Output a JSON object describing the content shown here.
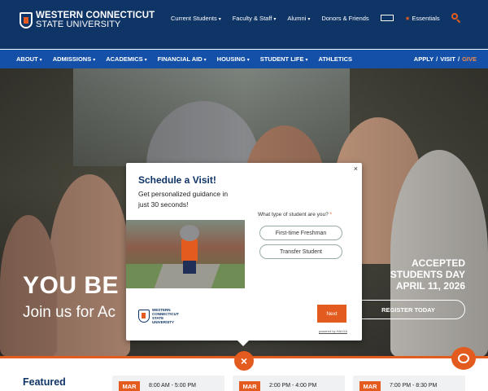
{
  "header": {
    "logo_line1": "WESTERN CONNECTICUT",
    "logo_line2": "STATE UNIVERSITY",
    "top_links": [
      {
        "label": "Current Students",
        "has_menu": true
      },
      {
        "label": "Faculty & Staff",
        "has_menu": true
      },
      {
        "label": "Alumni",
        "has_menu": true
      },
      {
        "label": "Donors & Friends",
        "has_menu": false
      }
    ],
    "language_icon": "translate-icon",
    "essentials_label": "Essentials",
    "essentials_icon": "star-icon",
    "search_icon": "search-icon"
  },
  "nav": {
    "items": [
      {
        "label": "ABOUT"
      },
      {
        "label": "ADMISSIONS"
      },
      {
        "label": "ACADEMICS"
      },
      {
        "label": "FINANCIAL AID"
      },
      {
        "label": "HOUSING"
      },
      {
        "label": "STUDENT LIFE"
      },
      {
        "label": "ATHLETICS"
      }
    ],
    "cta_apply": "APPLY",
    "cta_sep": "/",
    "cta_visit": "VISIT",
    "cta_give": "GIVE"
  },
  "hero": {
    "title": "YOU BE",
    "subtitle": "Join us for Ac",
    "accepted_line1": "ACCEPTED",
    "accepted_line2": "STUDENTS DAY",
    "accepted_line3": "APRIL 11, 2026",
    "register_label": "REGISTER TODAY"
  },
  "popup": {
    "title": "Schedule a Visit!",
    "description": "Get personalized guidance in just 30 seconds!",
    "close_label": "×",
    "question": "What type of student are you?",
    "required_mark": "*",
    "options": [
      "First-time Freshman",
      "Transfer Student"
    ],
    "logo_line1": "WESTERN",
    "logo_line2": "CONNECTICUT",
    "logo_line3": "STATE",
    "logo_line4": "UNIVERSITY",
    "next_label": "Next",
    "powered_by": "powered by HALDA"
  },
  "overlay_close_label": "×",
  "chat_icon": "chat-icon",
  "featured": {
    "heading": "Featured",
    "events": [
      {
        "month": "MAR",
        "time": "8:00 AM - 5:00 PM"
      },
      {
        "month": "MAR",
        "time": "2:00 PM - 4:00 PM"
      },
      {
        "month": "MAR",
        "time": "7:00 PM - 8:30 PM"
      }
    ]
  },
  "colors": {
    "navy": "#0f3466",
    "nav_blue": "#1450a8",
    "accent_orange": "#e35b1e"
  }
}
